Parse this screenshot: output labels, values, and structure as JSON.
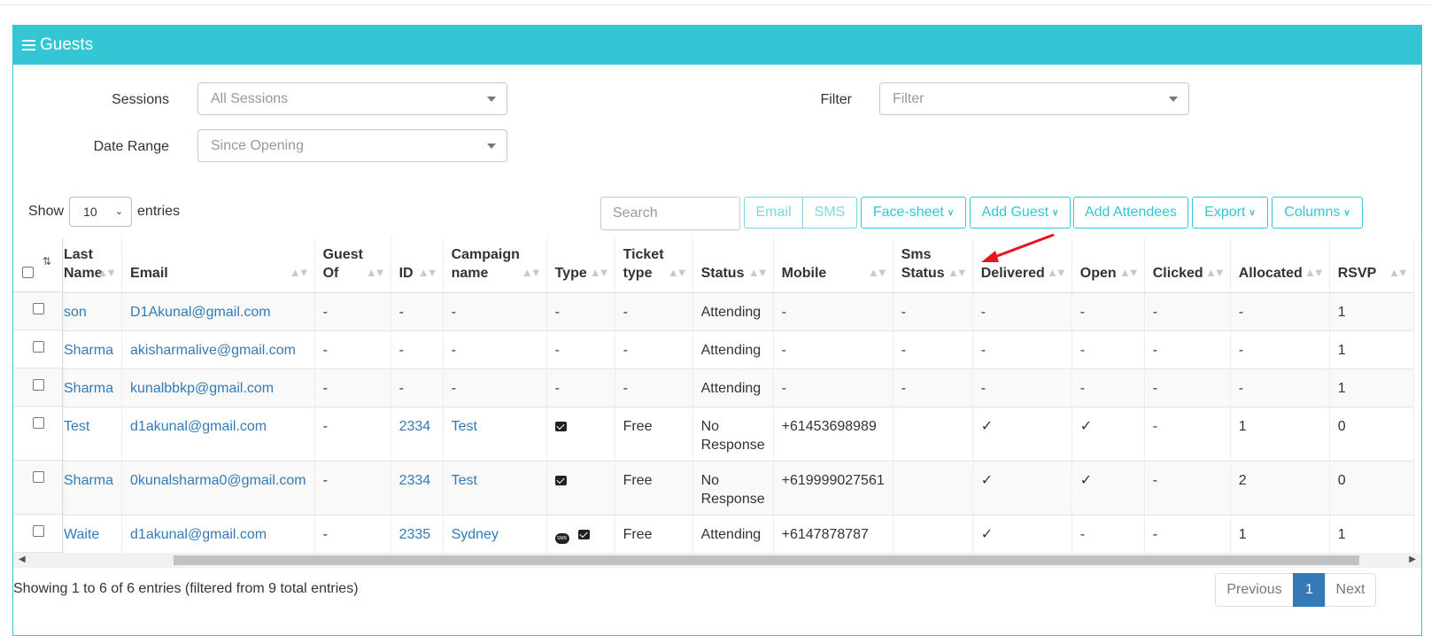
{
  "panel": {
    "title": "Guests"
  },
  "filters": {
    "sessions_label": "Sessions",
    "sessions_value": "All Sessions",
    "filter_label": "Filter",
    "filter_value": "Filter",
    "date_label": "Date Range",
    "date_value": "Since Opening"
  },
  "table_controls": {
    "show_label": "Show",
    "entries_value": "10",
    "entries_label": "entries",
    "search_placeholder": "Search",
    "btn_email": "Email",
    "btn_sms": "SMS",
    "btn_facesheet": "Face-sheet",
    "btn_add_guest": "Add Guest",
    "btn_add_attendees": "Add Attendees",
    "btn_export": "Export",
    "btn_columns": "Columns"
  },
  "columns": {
    "name": "Last Name",
    "email": "Email",
    "guest_of": "Guest Of",
    "id": "ID",
    "campaign": "Campaign name",
    "type": "Type",
    "ticket": "Ticket type",
    "status": "Status",
    "mobile": "Mobile",
    "sms_status": "Sms Status",
    "delivered": "Delivered",
    "open": "Open",
    "clicked": "Clicked",
    "allocated": "Allocated",
    "rsvp": "RSVP"
  },
  "rows": [
    {
      "name": "son",
      "email": "D1Akunal@gmail.com",
      "guest_of": "-",
      "id": "-",
      "campaign": "-",
      "type": "-",
      "ticket": "-",
      "status": "Attending",
      "mobile": "-",
      "sms_status": "-",
      "delivered": "-",
      "open": "-",
      "clicked": "-",
      "allocated": "-",
      "rsvp": "1"
    },
    {
      "name": "Sharma",
      "email": "akisharmalive@gmail.com",
      "guest_of": "-",
      "id": "-",
      "campaign": "-",
      "type": "-",
      "ticket": "-",
      "status": "Attending",
      "mobile": "-",
      "sms_status": "-",
      "delivered": "-",
      "open": "-",
      "clicked": "-",
      "allocated": "-",
      "rsvp": "1"
    },
    {
      "name": "Sharma",
      "email": "kunalbbkp@gmail.com",
      "guest_of": "-",
      "id": "-",
      "campaign": "-",
      "type": "-",
      "ticket": "-",
      "status": "Attending",
      "mobile": "-",
      "sms_status": "-",
      "delivered": "-",
      "open": "-",
      "clicked": "-",
      "allocated": "-",
      "rsvp": "1"
    },
    {
      "name": "Test",
      "email": "d1akunal@gmail.com",
      "guest_of": "-",
      "id": "2334",
      "campaign": "Test",
      "type": "email",
      "ticket": "Free",
      "status": "No Response",
      "mobile": "+61453698989",
      "sms_status": "",
      "delivered": "✓",
      "open": "✓",
      "clicked": "-",
      "allocated": "1",
      "rsvp": "0"
    },
    {
      "name": "Sharma",
      "email": "0kunalsharma0@gmail.com",
      "guest_of": "-",
      "id": "2334",
      "campaign": "Test",
      "type": "email",
      "ticket": "Free",
      "status": "No Response",
      "mobile": "+619999027561",
      "sms_status": "",
      "delivered": "✓",
      "open": "✓",
      "clicked": "-",
      "allocated": "2",
      "rsvp": "0"
    },
    {
      "name": "Waite",
      "email": "d1akunal@gmail.com",
      "guest_of": "-",
      "id": "2335",
      "campaign": "Sydney",
      "type": "sms+email",
      "ticket": "Free",
      "status": "Attending",
      "mobile": "+6147878787",
      "sms_status": "",
      "delivered": "✓",
      "open": "-",
      "clicked": "-",
      "allocated": "1",
      "rsvp": "1"
    }
  ],
  "footer": {
    "info": "Showing 1 to 6 of 6 entries (filtered from 9 total entries)",
    "prev": "Previous",
    "page": "1",
    "next": "Next"
  },
  "colors": {
    "accent": "#34c6d4",
    "link": "#337ab7",
    "annotation_arrow": "#e8161c"
  }
}
